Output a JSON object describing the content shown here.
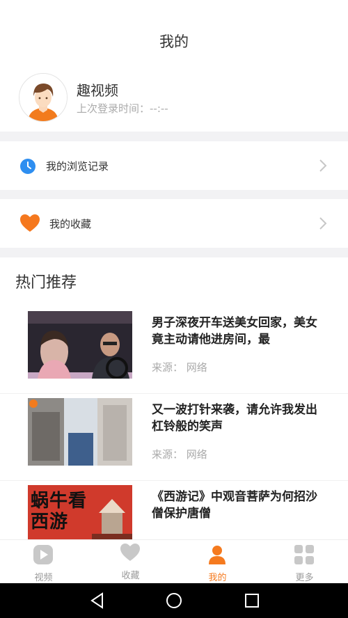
{
  "header": {
    "title": "我的"
  },
  "profile": {
    "avatar_icon": "user-avatar-icon",
    "name": "趣视频",
    "last_login": "上次登录时间：--:--"
  },
  "menu": [
    {
      "label": "我的浏览记录",
      "icon": "clock-icon",
      "icon_color": "#2e8ef0"
    },
    {
      "label": "我的收藏",
      "icon": "heart-icon",
      "icon_color": "#f5781e"
    }
  ],
  "hot": {
    "title": "热门推荐",
    "items": [
      {
        "headline": "男子深夜开车送美女回家，美女竟主动请他进房间，最",
        "source": "来源：  网络"
      },
      {
        "headline": "又一波打针来袭，请允许我发出杠铃般的笑声",
        "source": "来源：  网络"
      },
      {
        "headline": "《西游记》中观音菩萨为何招沙僧保护唐僧",
        "source": "",
        "thumb_text": "蜗牛看西游"
      }
    ]
  },
  "tabs": [
    {
      "label": "视频",
      "icon": "play-icon"
    },
    {
      "label": "收藏",
      "icon": "heart-icon"
    },
    {
      "label": "我的",
      "icon": "person-icon",
      "active": true
    },
    {
      "label": "更多",
      "icon": "grid-icon"
    }
  ],
  "colors": {
    "accent": "#f5781e",
    "inactive": "#c8c8c8",
    "blue": "#2e8ef0"
  }
}
